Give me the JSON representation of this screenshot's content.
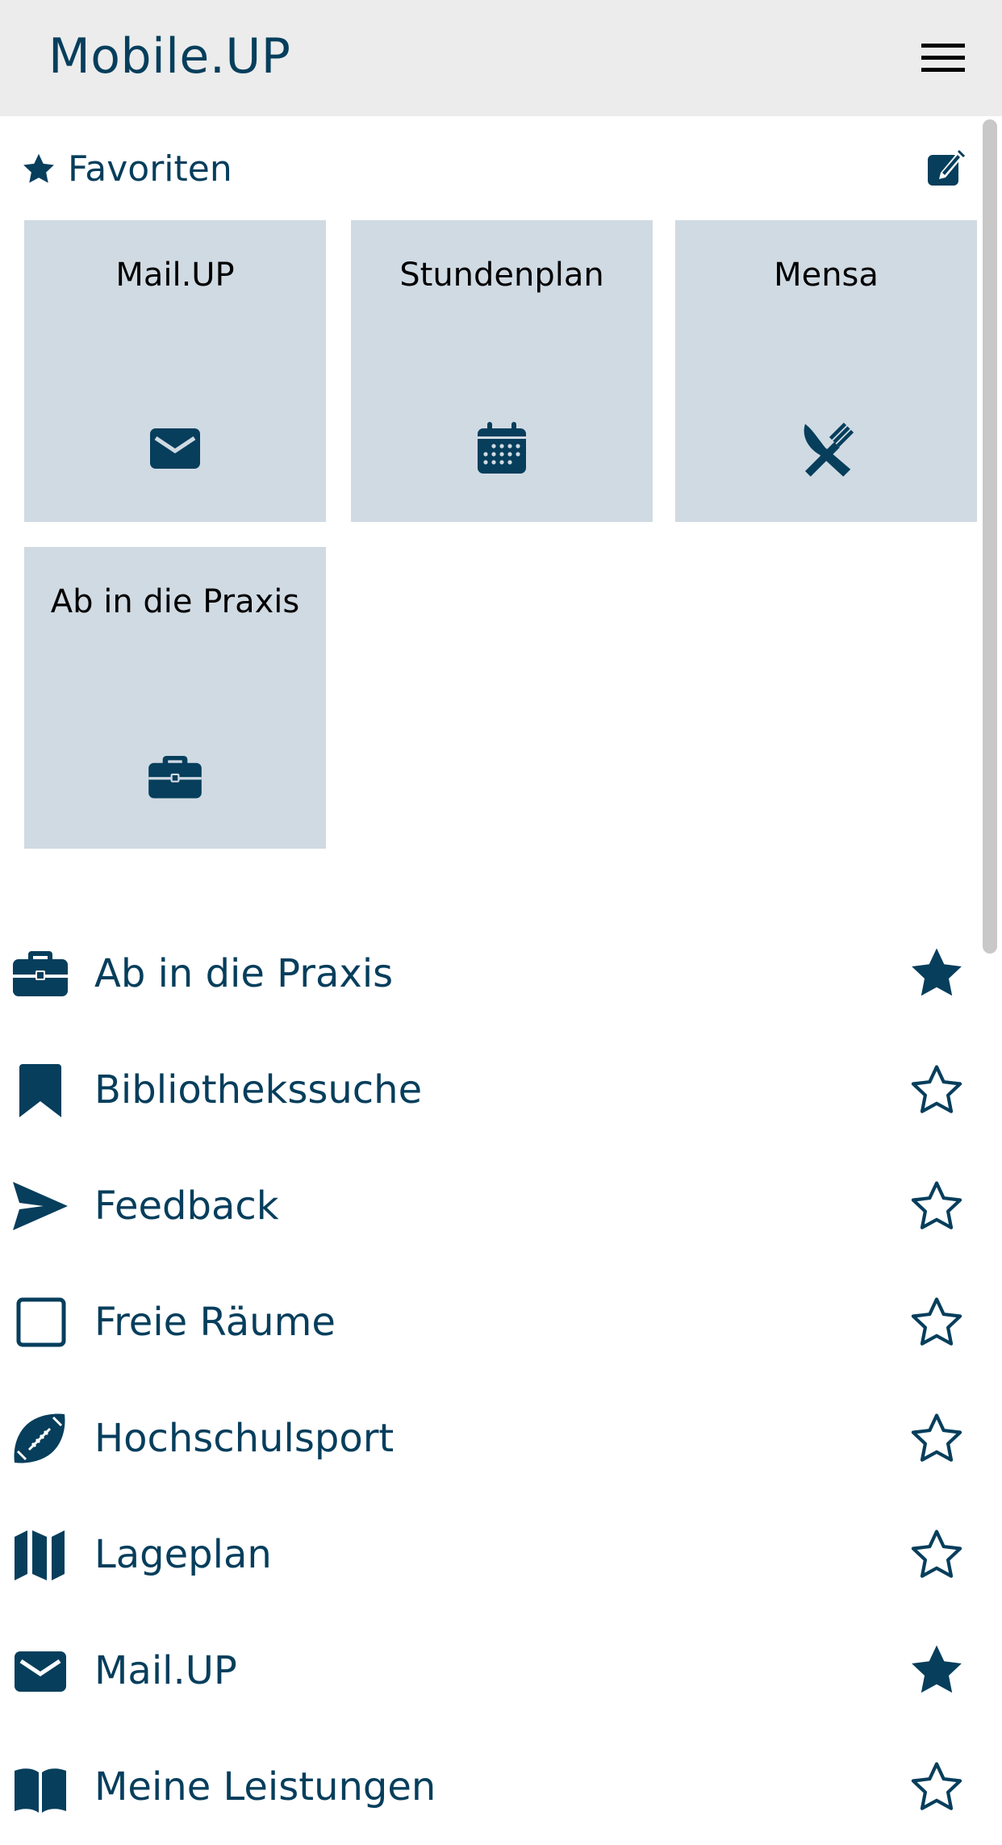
{
  "app": {
    "title": "Mobile.UP"
  },
  "colors": {
    "primary": "#063e5c",
    "header_bg": "#ececec",
    "tile_bg": "#d0dae3",
    "tile_text": "#000000"
  },
  "favorites": {
    "header_label": "Favoriten",
    "header_icon": "star-icon",
    "edit_icon": "edit-icon",
    "tiles": [
      {
        "label": "Mail.UP",
        "icon": "envelope-icon"
      },
      {
        "label": "Stundenplan",
        "icon": "calendar-icon"
      },
      {
        "label": "Mensa",
        "icon": "utensils-icon"
      },
      {
        "label": "Ab in die Praxis",
        "icon": "briefcase-icon"
      }
    ]
  },
  "modules": [
    {
      "label": "Ab in die Praxis",
      "icon": "briefcase-icon",
      "favorite": true
    },
    {
      "label": "Bibliothekssuche",
      "icon": "bookmark-icon",
      "favorite": false
    },
    {
      "label": "Feedback",
      "icon": "paper-plane-icon",
      "favorite": false
    },
    {
      "label": "Freie Räume",
      "icon": "square-icon",
      "favorite": false
    },
    {
      "label": "Hochschulsport",
      "icon": "football-icon",
      "favorite": false
    },
    {
      "label": "Lageplan",
      "icon": "map-icon",
      "favorite": false
    },
    {
      "label": "Mail.UP",
      "icon": "envelope-icon",
      "favorite": true
    },
    {
      "label": "Meine Leistungen",
      "icon": "book-icon",
      "favorite": false
    }
  ]
}
